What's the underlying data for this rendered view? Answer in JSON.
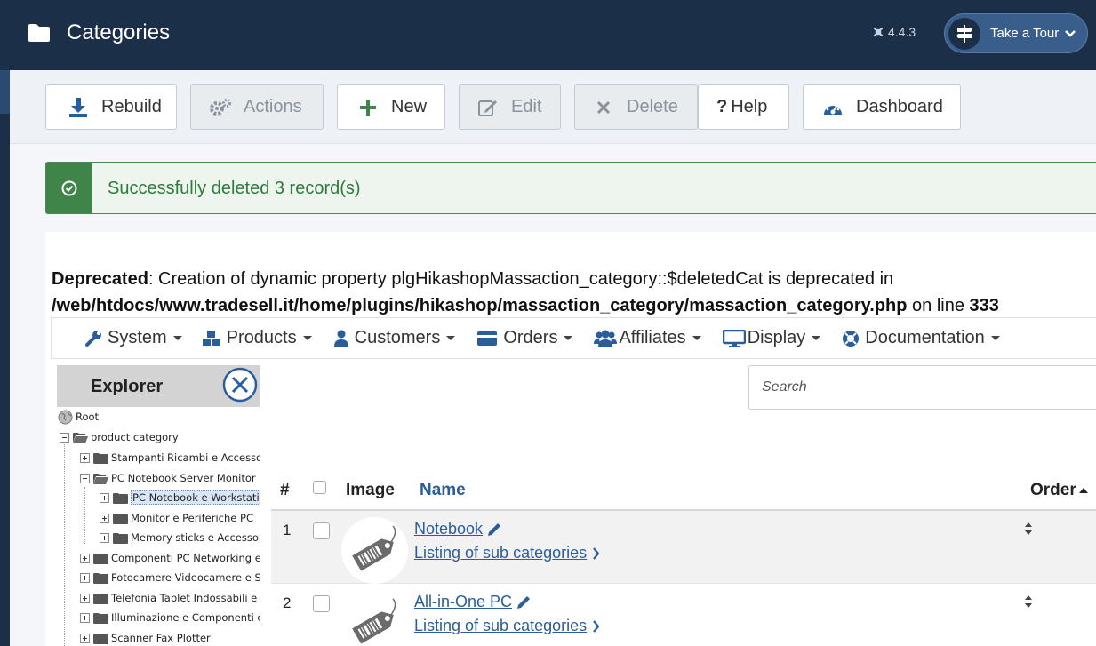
{
  "header": {
    "title": "Categories",
    "version": "4.4.3",
    "tour_label": "Take a Tour"
  },
  "toolbar": {
    "rebuild": "Rebuild",
    "actions": "Actions",
    "new": "New",
    "edit": "Edit",
    "delete": "Delete",
    "help": "Help",
    "dashboard": "Dashboard"
  },
  "alert": {
    "message": "Successfully deleted 3 record(s)"
  },
  "warning": {
    "label": "Deprecated",
    "text": ": Creation of dynamic property plgHikashopMassaction_category::$deletedCat is deprecated in",
    "path": "/web/htdocs/www.tradesell.it/home/plugins/hikashop/massaction_category/massaction_category.php",
    "on_line": " on line ",
    "line": "333"
  },
  "menu": {
    "system": "System",
    "products": "Products",
    "customers": "Customers",
    "orders": "Orders",
    "affiliates": "Affiliates",
    "display": "Display",
    "documentation": "Documentation"
  },
  "explorer": {
    "title": "Explorer",
    "root": "Root",
    "product_category": "product category",
    "items": [
      "Stampanti Ricambi e Accesso",
      "PC Notebook Server Monitor",
      "PC Notebook e Workstatio",
      "Monitor e Periferiche PC",
      "Memory sticks e Accessor",
      "Componenti PC Networking e",
      "Fotocamere Videocamere e S",
      "Telefonia Tablet Indossabili e",
      "Illuminazione e Componenti e",
      "Scanner Fax Plotter"
    ]
  },
  "search": {
    "placeholder": "Search"
  },
  "table": {
    "col_num": "#",
    "col_image": "Image",
    "col_name": "Name",
    "col_order": "Order",
    "rows": [
      {
        "num": "1",
        "name": "Notebook",
        "sub": "Listing of sub categories"
      },
      {
        "num": "2",
        "name": "All-in-One PC",
        "sub": "Listing of sub categories"
      }
    ]
  }
}
